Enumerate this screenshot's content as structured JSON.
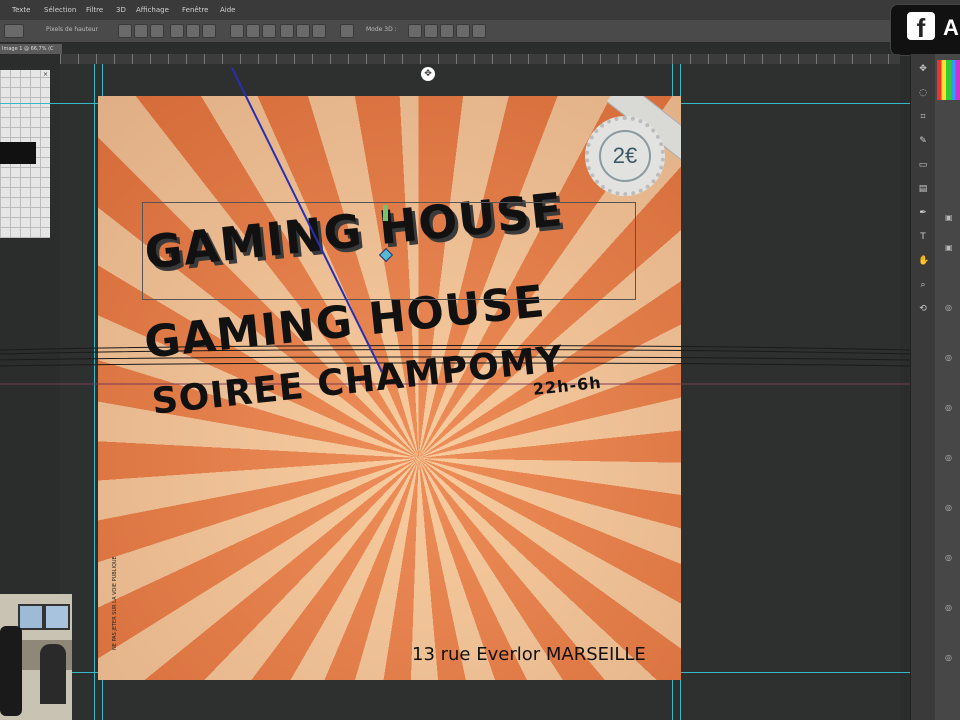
{
  "menu": [
    "Texte",
    "Sélection",
    "Filtre",
    "3D",
    "Affichage",
    "Fenêtre",
    "Aide"
  ],
  "options_bar": {
    "field_text": "Pixels de hauteur",
    "mode_label": "Mode 3D :"
  },
  "doc_tab": "Image 1 @ 66,7% (C",
  "social": {
    "logo_letter": "f",
    "trailing": "A"
  },
  "poster": {
    "price": "2€",
    "title_1": "GAMING HOUSE",
    "title_2": "GAMING HOUSE",
    "subtitle": "SOIREE CHAMPOMY",
    "hours": "22h-6h",
    "address": "13 rue Everlor MARSEILLE",
    "vertical_note": "NE PAS JETER SUR LA VOIE PUBLIQUE"
  },
  "colors": {
    "ray_orange": "#e8743e",
    "ray_cream": "#f6c79c",
    "guide": "#36b9c7",
    "workspace": "#2e302f"
  },
  "icons": [
    "move-icon",
    "lasso-icon",
    "crop-icon",
    "brush-icon",
    "eraser-icon",
    "gradient-icon",
    "pen-icon",
    "type-icon",
    "hand-icon",
    "zoom-icon",
    "3d-rotate-icon"
  ]
}
